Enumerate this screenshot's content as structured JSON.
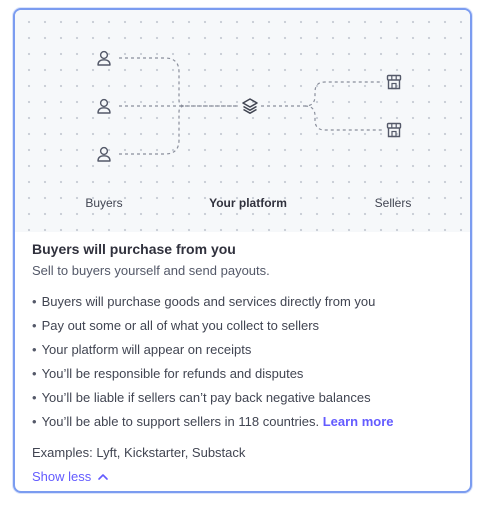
{
  "diagram": {
    "columns": {
      "buyers": "Buyers",
      "platform": "Your platform",
      "sellers": "Sellers"
    },
    "icons": {
      "buyer": "person-icon",
      "platform": "layers-icon",
      "seller": "storefront-icon"
    },
    "line_color": "#8a8f9c"
  },
  "option": {
    "title": "Buyers will purchase from you",
    "subtitle": "Sell to buyers yourself and send payouts.",
    "bullets": [
      "Buyers will purchase goods and services directly from you",
      "Pay out some or all of what you collect to sellers",
      "Your platform will appear on receipts",
      "You’ll be responsible for refunds and disputes",
      "You’ll be liable if sellers can’t pay back negative balances",
      "You’ll be able to support sellers in 118 countries."
    ],
    "learn_more": "Learn more",
    "examples_label": "Examples:",
    "examples": "Lyft, Kickstarter, Substack",
    "show_less": "Show less"
  },
  "colors": {
    "accent": "#635bff",
    "selected_border": "#7b9cf0"
  }
}
